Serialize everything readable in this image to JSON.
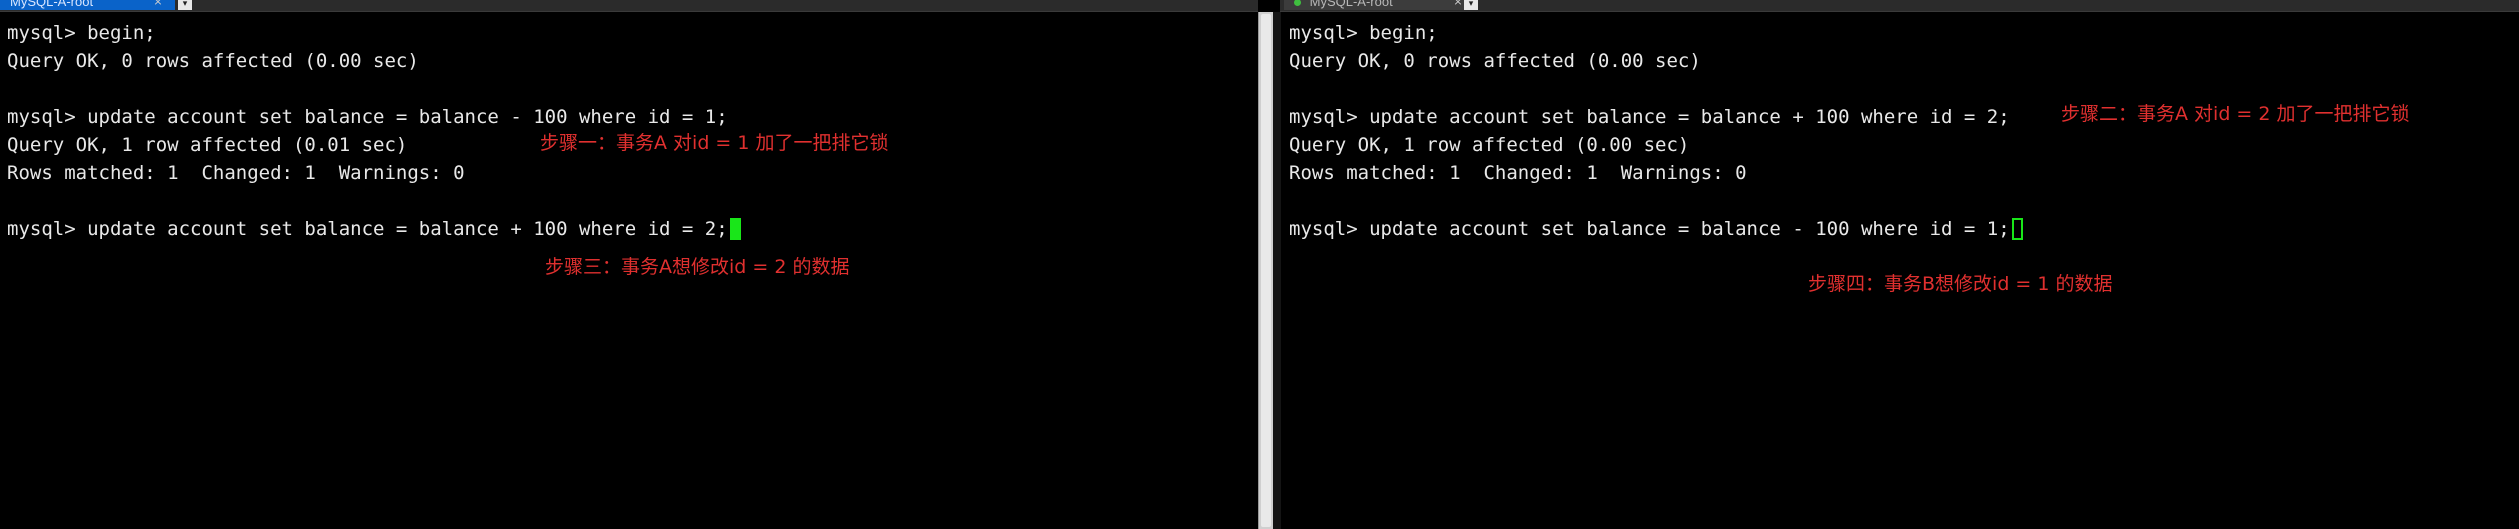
{
  "tabs": {
    "left_title": "MySQL-A-root",
    "right_title": "MySQL-A-root"
  },
  "left_terminal": {
    "lines": [
      "mysql> begin;",
      "Query OK, 0 rows affected (0.00 sec)",
      "",
      "mysql> update account set balance = balance - 100 where id = 1;",
      "Query OK, 1 row affected (0.01 sec)",
      "Rows matched: 1  Changed: 1  Warnings: 0",
      "",
      "mysql> update account set balance = balance + 100 where id = 2;"
    ],
    "annotations": {
      "step1": "步骤一：事务A 对id = 1 加了一把排它锁",
      "step3": "步骤三：事务A想修改id = 2 的数据"
    }
  },
  "right_terminal": {
    "lines": [
      "mysql> begin;",
      "Query OK, 0 rows affected (0.00 sec)",
      "",
      "mysql> update account set balance = balance + 100 where id = 2;",
      "Query OK, 1 row affected (0.00 sec)",
      "Rows matched: 1  Changed: 1  Warnings: 0",
      "",
      "mysql> update account set balance = balance - 100 where id = 1;"
    ],
    "annotations": {
      "step2": "步骤二：事务A 对id = 2 加了一把排它锁",
      "step4": "步骤四：事务B想修改id = 1 的数据"
    }
  },
  "colors": {
    "background": "#000000",
    "text": "#e8e8e8",
    "annotation": "#e0302f",
    "cursor": "#19e619",
    "active_tab": "#0a63c9"
  },
  "icons": {
    "tab_close": "close-icon",
    "tab_menu": "chevron-down-icon",
    "tab_status": "status-dot-icon"
  }
}
